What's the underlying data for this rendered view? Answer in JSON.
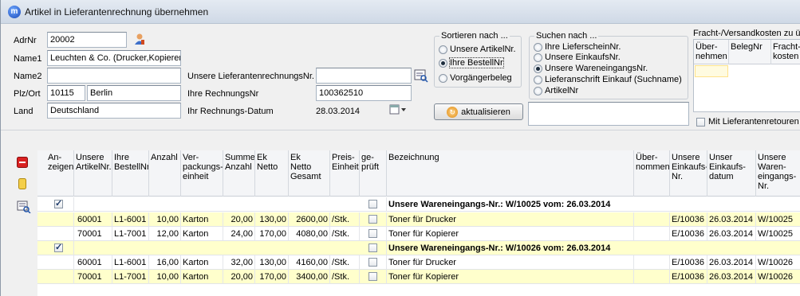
{
  "window": {
    "title": "Artikel in Lieferantenrechnung übernehmen"
  },
  "form": {
    "adrnr_label": "AdrNr",
    "adrnr_value": "20002",
    "name1_label": "Name1",
    "name1_value": "Leuchten & Co. (Drucker,Kopierer",
    "name2_label": "Name2",
    "name2_value": "",
    "plzort_label": "Plz/Ort",
    "plz_value": "10115",
    "ort_value": "Berlin",
    "land_label": "Land",
    "land_value": "Deutschland",
    "unsere_lrnr_label": "Unsere LieferantenrechnungsNr.",
    "unsere_lrnr_value": "",
    "ihre_rnr_label": "Ihre RechnungsNr",
    "ihre_rnr_value": "100362510",
    "datum_label": "Ihr Rechnungs-Datum",
    "datum_value": "28.03.2014"
  },
  "sortieren": {
    "caption": "Sortieren nach ...",
    "options": [
      "Unsere ArtikelNr.",
      "Ihre BestellNr",
      "Vorgängerbeleg"
    ],
    "selected": 1,
    "refresh_label": "aktualisieren"
  },
  "suchen": {
    "caption": "Suchen nach ...",
    "options": [
      "Ihre LieferscheinNr.",
      "Unsere EinkaufsNr.",
      "Unsere WareneingangsNr.",
      "Lieferanschrift Einkauf (Suchname)",
      "ArtikelNr"
    ],
    "selected": 2,
    "search_value": ""
  },
  "fracht": {
    "caption": "Fracht-/Versandkosten zu üb",
    "headers": [
      "Über-\nnehmen",
      "BelegNr",
      "Fracht-\nkosten"
    ],
    "retouren_label": "Mit Lieferantenretouren"
  },
  "grid": {
    "headers": [
      "An-\nzeigen",
      "Unsere\nArtikelNr.",
      "Ihre\nBestellNr",
      "Anzahl",
      "Ver-\npackungs-\neinheit",
      "Summe\nAnzahl",
      "Ek\nNetto",
      "Ek\nNetto\nGesamt",
      "Preis-\nEinheit",
      "ge-\nprüft",
      "Bezeichnung",
      "Über-\nnommen",
      "Unsere\nEinkaufs-\nNr.",
      "Unser\nEinkaufs-\ndatum",
      "Unsere\nWaren-\neingangs-\nNr."
    ],
    "rows": [
      {
        "type": "group",
        "checked": true,
        "bezeichnung": "Unsere Wareneingangs-Nr.: W/10025 vom: 26.03.2014"
      },
      {
        "type": "item",
        "artikel": "60001",
        "bestell": "L1-6001",
        "anzahl": "10,00",
        "vpe": "Karton",
        "summe": "20,00",
        "ek": "130,00",
        "gesamt": "2600,00",
        "pe": "/Stk.",
        "bezeichnung": "Toner für Drucker",
        "einkaufsnr": "E/10036",
        "datum": "26.03.2014",
        "wenr": "W/10025"
      },
      {
        "type": "item",
        "artikel": "70001",
        "bestell": "L1-7001",
        "anzahl": "12,00",
        "vpe": "Karton",
        "summe": "24,00",
        "ek": "170,00",
        "gesamt": "4080,00",
        "pe": "/Stk.",
        "bezeichnung": "Toner für Kopierer",
        "einkaufsnr": "E/10036",
        "datum": "26.03.2014",
        "wenr": "W/10025"
      },
      {
        "type": "group",
        "checked": true,
        "bezeichnung": "Unsere Wareneingangs-Nr.: W/10026 vom: 26.03.2014"
      },
      {
        "type": "item",
        "artikel": "60001",
        "bestell": "L1-6001",
        "anzahl": "16,00",
        "vpe": "Karton",
        "summe": "32,00",
        "ek": "130,00",
        "gesamt": "4160,00",
        "pe": "/Stk.",
        "bezeichnung": "Toner für Drucker",
        "einkaufsnr": "E/10036",
        "datum": "26.03.2014",
        "wenr": "W/10026"
      },
      {
        "type": "item",
        "artikel": "70001",
        "bestell": "L1-7001",
        "anzahl": "10,00",
        "vpe": "Karton",
        "summe": "20,00",
        "ek": "170,00",
        "gesamt": "3400,00",
        "pe": "/Stk.",
        "bezeichnung": "Toner für Kopierer",
        "einkaufsnr": "E/10036",
        "datum": "26.03.2014",
        "wenr": "W/10026"
      }
    ]
  },
  "colors": {
    "row_yellow": "#ffffcc",
    "accent": "#1848b8"
  }
}
